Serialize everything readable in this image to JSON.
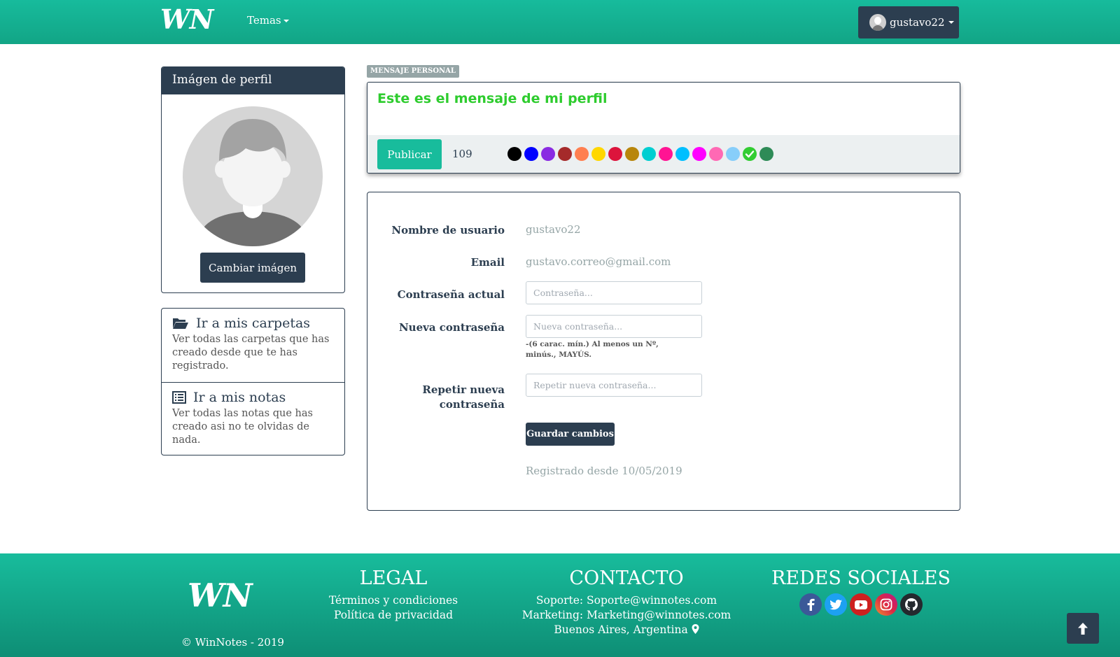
{
  "navbar": {
    "brand": "WN",
    "menu_label": "Temas",
    "user_label": "gustavo22"
  },
  "profile_card": {
    "header": "Imágen de perfil",
    "change_button": "Cambiar imágen"
  },
  "links": [
    {
      "title": "Ir a mis carpetas",
      "description": "Ver todas las carpetas que has creado desde que te has registrado.",
      "icon": "folder-open-icon"
    },
    {
      "title": "Ir a mis notas",
      "description": "Ver todas las notas que has creado asi no te olvidas de nada.",
      "icon": "list-icon"
    }
  ],
  "message": {
    "badge": "MENSAJE PERSONAL",
    "text": "Este es el mensaje de mi perfil",
    "text_color": "#2ecc2e",
    "publish_button": "Publicar",
    "char_count": "109",
    "colors": [
      "#000000",
      "#0000ff",
      "#8a2be2",
      "#a52a2a",
      "#ff7f50",
      "#ffd700",
      "#dc143c",
      "#b8860b",
      "#00ced1",
      "#ff1493",
      "#00bfff",
      "#ff00ff",
      "#ff69b4",
      "#87cefa",
      "#32cd32",
      "#2e8b57"
    ],
    "selected_color_index": 14
  },
  "form": {
    "username_label": "Nombre de usuario",
    "username_value": "gustavo22",
    "email_label": "Email",
    "email_value": "gustavo.correo@gmail.com",
    "current_password_label": "Contraseña actual",
    "current_password_placeholder": "Contraseña...",
    "new_password_label": "Nueva contraseña",
    "new_password_placeholder": "Nueva contraseña...",
    "new_password_help": "-(6 carac. mín.) Al menos un Nº, minús., MAYÚS.",
    "repeat_password_label_1": "Repetir nueva",
    "repeat_password_label_2": "contraseña",
    "repeat_password_placeholder": "Repetir nueva contraseña...",
    "save_button": "Guardar cambios",
    "registered_text": "Registrado desde 10/05/2019"
  },
  "footer": {
    "brand": "WN",
    "copyright": "© WinNotes - 2019",
    "legal": {
      "title": "LEGAL",
      "items": [
        "Términos y condiciones",
        "Política de privacidad"
      ]
    },
    "contact": {
      "title": "CONTACTO",
      "items": [
        "Soporte: Soporte@winnotes.com",
        "Marketing: Marketing@winnotes.com",
        "Buenos Aires, Argentina"
      ]
    },
    "social": {
      "title": "REDES SOCIALES",
      "networks": [
        "facebook-icon",
        "twitter-icon",
        "youtube-icon",
        "instagram-icon",
        "github-icon"
      ]
    }
  },
  "theme": {
    "primary": "#18bc9c",
    "dark": "#2c3e50",
    "muted": "#95a5a6"
  }
}
